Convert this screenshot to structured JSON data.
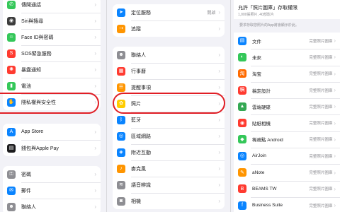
{
  "col1": {
    "groups": [
      [
        {
          "label": "傳聞通話",
          "color": "#34c759",
          "icon": "phone-icon",
          "glyph": "✆"
        },
        {
          "label": "Siri與搜尋",
          "color": "#3d3d3d",
          "icon": "siri-icon",
          "glyph": "◉"
        },
        {
          "label": "Face ID與密碼",
          "color": "#34c759",
          "icon": "face-id-icon",
          "glyph": "☺"
        },
        {
          "label": "SOS緊急服務",
          "color": "#ff3b30",
          "icon": "sos-icon",
          "glyph": "S"
        },
        {
          "label": "暴露通知",
          "color": "#ff3b30",
          "icon": "exposure-icon",
          "glyph": "✺"
        },
        {
          "label": "電池",
          "color": "#34c759",
          "icon": "battery-icon",
          "glyph": "▮"
        },
        {
          "label": "隱私權與安全性",
          "color": "#0a84ff",
          "icon": "hand-icon",
          "glyph": "✋"
        }
      ],
      [
        {
          "label": "App Store",
          "color": "#0a84ff",
          "icon": "app-store-icon",
          "glyph": "A"
        },
        {
          "label": "錢包與Apple Pay",
          "color": "#1c1c1e",
          "icon": "wallet-icon",
          "glyph": "▤"
        }
      ],
      [
        {
          "label": "密碼",
          "color": "#8e8e93",
          "icon": "key-icon",
          "glyph": "⚿"
        },
        {
          "label": "郵件",
          "color": "#0a84ff",
          "icon": "mail-icon",
          "glyph": "✉"
        },
        {
          "label": "聯絡人",
          "color": "#8e8e93",
          "icon": "contacts-icon",
          "glyph": "☻"
        }
      ]
    ]
  },
  "col2": {
    "groups": [
      [
        {
          "label": "定位服務",
          "value": "開啟",
          "color": "#0a84ff",
          "icon": "location-icon",
          "glyph": "➤"
        },
        {
          "label": "追蹤",
          "value": "",
          "color": "#ff9500",
          "icon": "tracking-icon",
          "glyph": "⇢"
        }
      ],
      [
        {
          "label": "聯絡人",
          "value": "",
          "color": "#8e8e93",
          "icon": "contacts-icon",
          "glyph": "☻"
        },
        {
          "label": "行事曆",
          "value": "",
          "color": "#ff3b30",
          "icon": "calendar-icon",
          "glyph": "▦"
        },
        {
          "label": "提醒事項",
          "value": "",
          "color": "#ff9500",
          "icon": "reminders-icon",
          "glyph": "☰"
        },
        {
          "label": "照片",
          "value": "",
          "color": "#ffcc00",
          "icon": "photos-icon",
          "glyph": "✿"
        },
        {
          "label": "藍牙",
          "value": "",
          "color": "#0a84ff",
          "icon": "bluetooth-icon",
          "glyph": "ᛒ"
        },
        {
          "label": "區域網路",
          "value": "",
          "color": "#0a84ff",
          "icon": "network-icon",
          "glyph": "◎"
        },
        {
          "label": "附近互動",
          "value": "",
          "color": "#0a84ff",
          "icon": "nearby-icon",
          "glyph": "◈"
        },
        {
          "label": "麥克風",
          "value": "",
          "color": "#ff9500",
          "icon": "microphone-icon",
          "glyph": "♪"
        },
        {
          "label": "語音辨識",
          "value": "",
          "color": "#8e8e93",
          "icon": "speech-icon",
          "glyph": "≋"
        },
        {
          "label": "相機",
          "value": "",
          "color": "#8e8e93",
          "icon": "camera-icon",
          "glyph": "◙"
        }
      ]
    ]
  },
  "col3": {
    "title": "允許「照片圖庫」存取權限",
    "subtitle": "1,000張照片, 40部影片",
    "description": "要求存取您照片的App將會顯示於此。",
    "apps": [
      {
        "label": "文件",
        "value": "完整照片圖庫",
        "color": "#0a84ff",
        "icon": "files-icon",
        "glyph": "▤"
      },
      {
        "label": "未來",
        "value": "完整照片圖庫",
        "color": "#34c759",
        "icon": "future-icon",
        "glyph": "◐"
      },
      {
        "label": "淘宝",
        "value": "完整照片圖庫",
        "color": "#ff6a00",
        "icon": "taobao-icon",
        "glyph": "淘"
      },
      {
        "label": "稿定設計",
        "value": "完整照片圖庫",
        "color": "#ff3b30",
        "icon": "gaoding-icon",
        "glyph": "稿"
      },
      {
        "label": "雲端硬碟",
        "value": "完整照片圖庫",
        "color": "#34a853",
        "icon": "drive-icon",
        "glyph": "▲"
      },
      {
        "label": "貼紙相機",
        "value": "完整照片圖庫",
        "color": "#ff3b30",
        "icon": "sticker-camera-icon",
        "glyph": "◉"
      },
      {
        "label": "稀疏點 Android",
        "value": "完整照片圖庫",
        "color": "#34c759",
        "icon": "android-icon",
        "glyph": "◆"
      },
      {
        "label": "AirJoin",
        "value": "完整照片圖庫",
        "color": "#0a84ff",
        "icon": "airjoin-icon",
        "glyph": "◎"
      },
      {
        "label": "aNote",
        "value": "完整照片圖庫",
        "color": "#ff9500",
        "icon": "anote-icon",
        "glyph": "✎"
      },
      {
        "label": "BEAMS TW",
        "value": "完整照片圖庫",
        "color": "#ff3b30",
        "icon": "beams-icon",
        "glyph": "B"
      },
      {
        "label": "Business Suite",
        "value": "完整照片圖庫",
        "color": "#0a84ff",
        "icon": "business-suite-icon",
        "glyph": "f"
      }
    ]
  },
  "highlight_color": "#e01e25"
}
